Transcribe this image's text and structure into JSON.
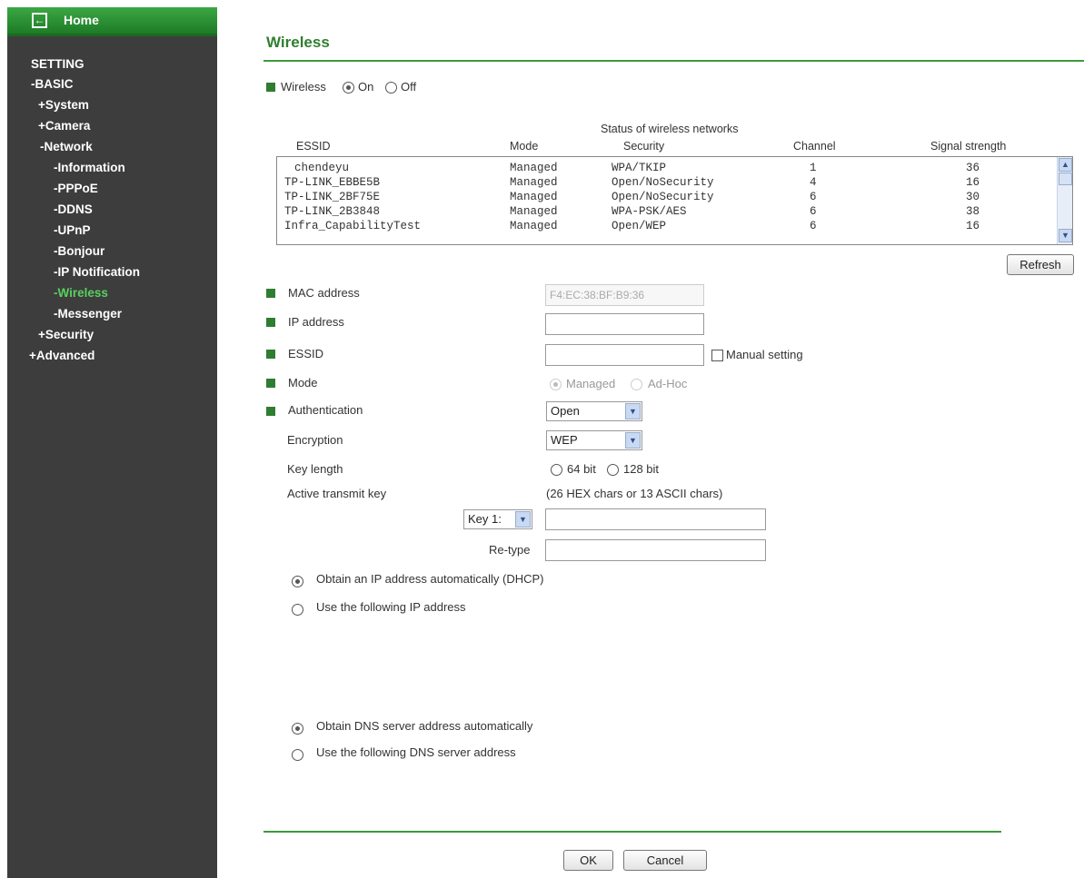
{
  "sidebar": {
    "home_label": "Home",
    "items": [
      {
        "label": "SETTING"
      },
      {
        "label": "-BASIC"
      },
      {
        "label": "+System"
      },
      {
        "label": "+Camera"
      },
      {
        "label": "-Network"
      },
      {
        "label": "-Information"
      },
      {
        "label": "-PPPoE"
      },
      {
        "label": "-DDNS"
      },
      {
        "label": "-UPnP"
      },
      {
        "label": "-Bonjour"
      },
      {
        "label": "-IP Notification"
      },
      {
        "label": "-Wireless"
      },
      {
        "label": "-Messenger"
      },
      {
        "label": "+Security"
      },
      {
        "label": "+Advanced"
      }
    ]
  },
  "page": {
    "title": "Wireless",
    "wireless_label": "Wireless",
    "on_label": "On",
    "off_label": "Off",
    "wireless_state": "On"
  },
  "networks": {
    "title": "Status of wireless networks",
    "columns": [
      "ESSID",
      "Mode",
      "Security",
      "Channel",
      "Signal strength"
    ],
    "rows": [
      [
        "chendeyu",
        "Managed",
        "WPA/TKIP",
        "1",
        "36"
      ],
      [
        "TP-LINK_EBBE5B",
        "Managed",
        "Open/NoSecurity",
        "4",
        "16"
      ],
      [
        "TP-LINK_2BF75E",
        "Managed",
        "Open/NoSecurity",
        "6",
        "30"
      ],
      [
        "TP-LINK_2B3848",
        "Managed",
        "WPA-PSK/AES",
        "6",
        "38"
      ],
      [
        "Infra_CapabilityTest",
        "Managed",
        "Open/WEP",
        "6",
        "16"
      ]
    ],
    "refresh_label": "Refresh"
  },
  "form": {
    "mac_label": "MAC address",
    "mac_value": "F4:EC:38:BF:B9:36",
    "ip_label": "IP address",
    "ip_value": "",
    "essid_label": "ESSID",
    "essid_value": "",
    "manual_setting_label": "Manual setting",
    "mode_label": "Mode",
    "mode_managed": "Managed",
    "mode_adhoc": "Ad-Hoc",
    "auth_label": "Authentication",
    "auth_value": "Open",
    "encryption_label": "Encryption",
    "encryption_value": "WEP",
    "key_length_label": "Key length",
    "key_64": "64 bit",
    "key_128": "128 bit",
    "active_key_label": "Active transmit key",
    "hex_hint": "(26 HEX chars or 13 ASCII chars)",
    "key_select_value": "Key 1:",
    "key_value": "",
    "retype_label": "Re-type",
    "retype_value": "",
    "dhcp_label": "Obtain an IP address automatically (DHCP)",
    "static_ip_label": "Use the following IP address",
    "dns_auto_label": "Obtain DNS server address automatically",
    "dns_static_label": "Use the following DNS server address"
  },
  "footer": {
    "ok_label": "OK",
    "cancel_label": "Cancel"
  },
  "colors": {
    "accent_green": "#2e7d32",
    "sidebar_bg": "#3d3d3d",
    "active_nav": "#58d05e"
  }
}
